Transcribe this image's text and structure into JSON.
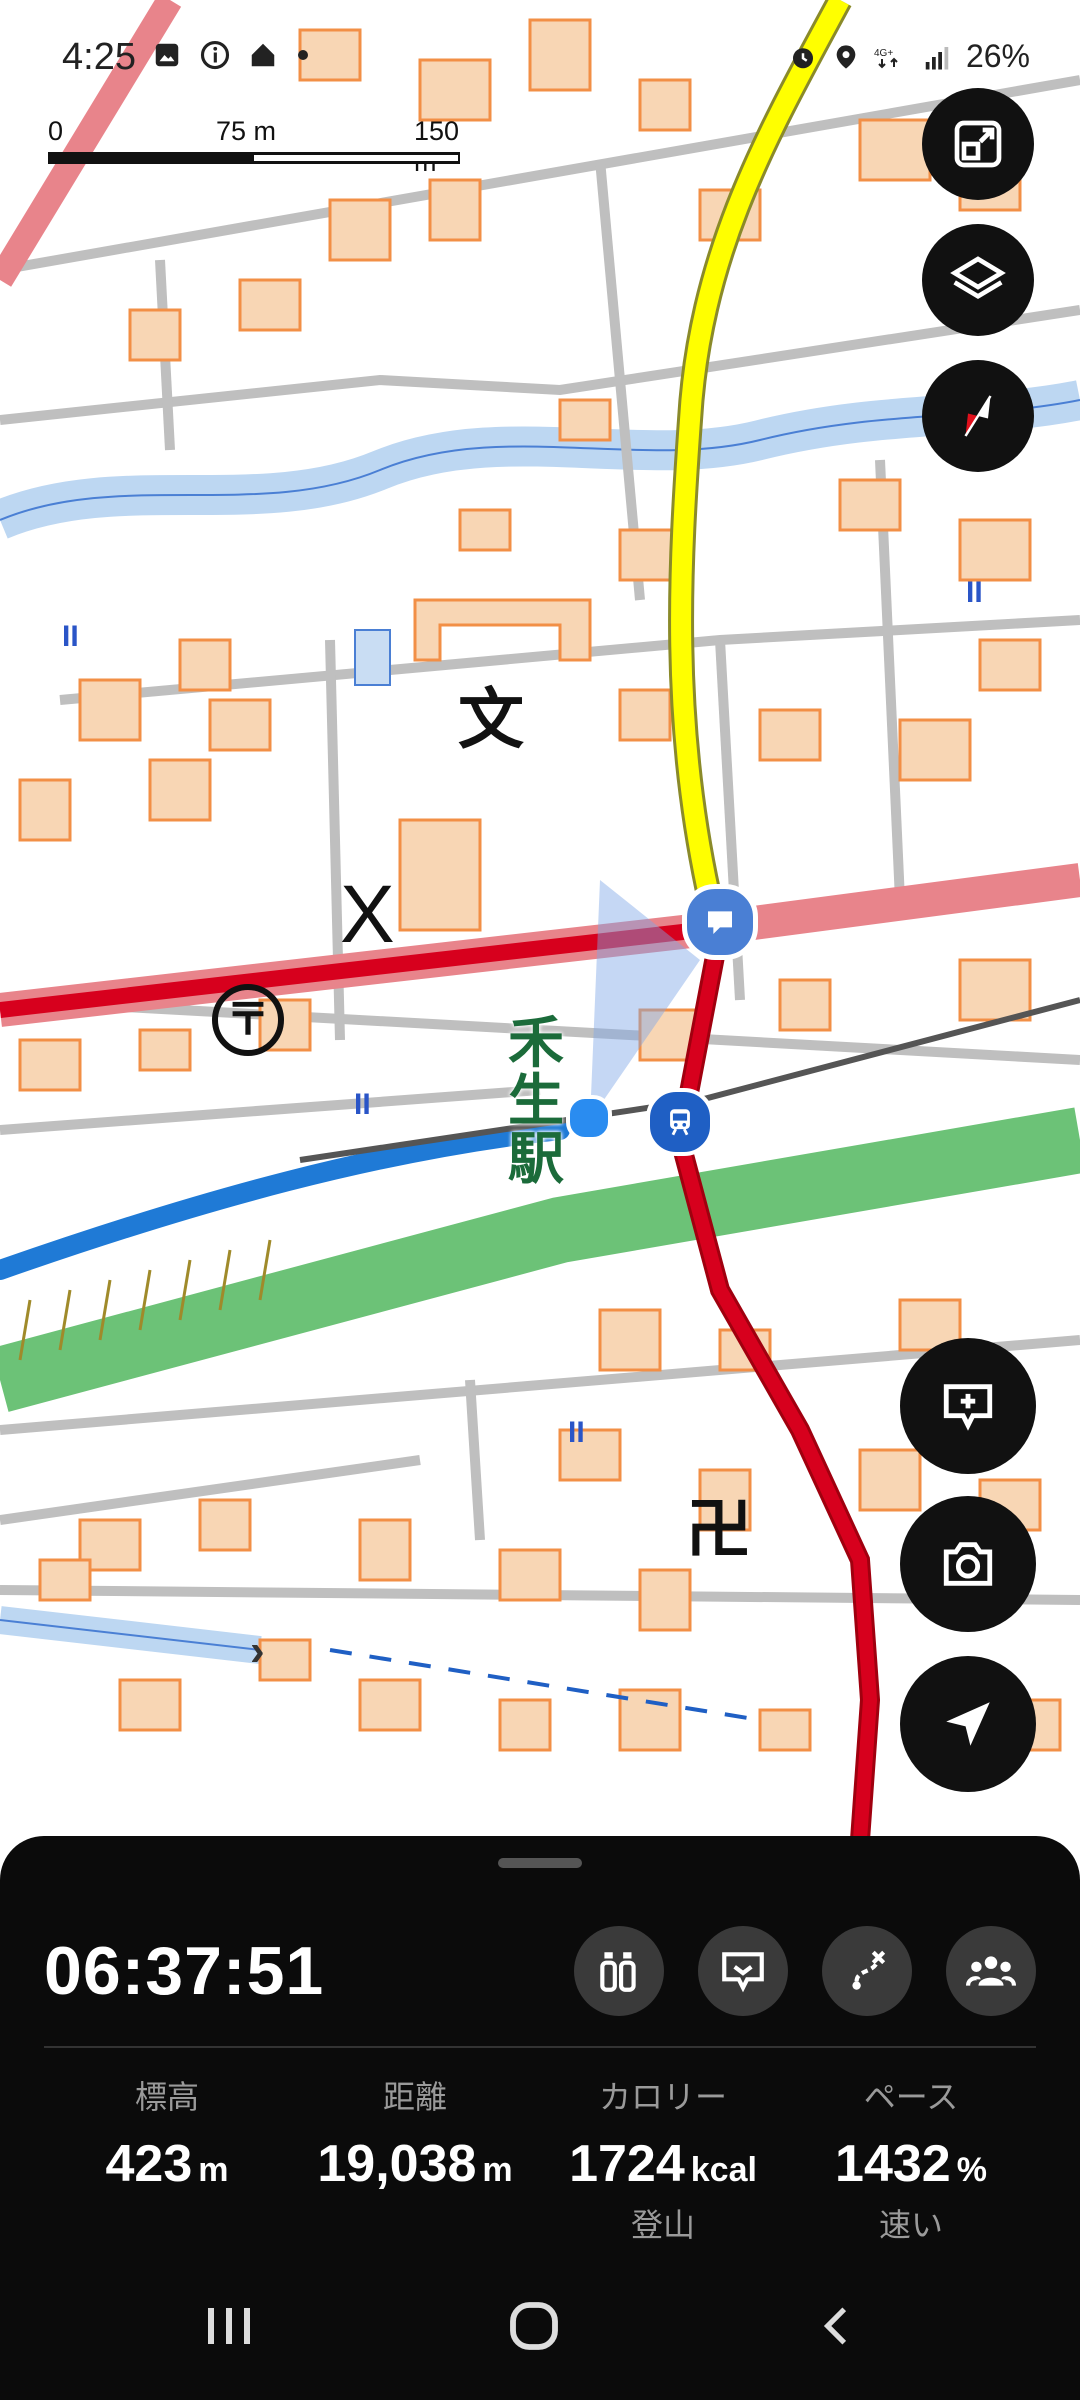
{
  "status_bar": {
    "time": "4:25",
    "battery": "26%",
    "left_icons": [
      "gallery-icon",
      "info-icon",
      "home-icon",
      "dot-icon"
    ],
    "right_icons": [
      "alarm-icon",
      "location-icon",
      "lte-icon",
      "signal-icon"
    ]
  },
  "scale_bar": {
    "label_0": "0",
    "label_1": "75 m",
    "label_2": "150 m"
  },
  "map": {
    "station_label_1": "禾",
    "station_label_2": "生",
    "station_label_3": "駅",
    "symbol_school": "文",
    "symbol_police": "X",
    "symbol_temple": "卍",
    "symbol_post": "〒",
    "symbol_field": "II",
    "colors": {
      "national_road": "#d7001d",
      "prefectural_road": "#ffff00",
      "rail_green": "#6cc277",
      "water": "#bdd7f2",
      "building": "#f8d6b4",
      "building_edge": "#f28f46"
    }
  },
  "map_controls": [
    "fit-screen-icon",
    "layers-icon",
    "compass-icon",
    "zoom-in-icon",
    "camera-icon",
    "navigate-icon"
  ],
  "panel": {
    "elapsed_time": "06:37:51",
    "action_icons": [
      "waypoint-icon",
      "memo-icon",
      "route-icon",
      "group-icon"
    ],
    "stats": [
      {
        "label": "標高",
        "value": "423",
        "unit": "m",
        "sub": ""
      },
      {
        "label": "距離",
        "value": "19,038",
        "unit": "m",
        "sub": ""
      },
      {
        "label": "カロリー",
        "value": "1724",
        "unit": "kcal",
        "sub": "登山"
      },
      {
        "label": "ペース",
        "value": "1432",
        "unit": "%",
        "sub": "速い"
      }
    ]
  },
  "nav_bar": [
    "recents-button",
    "home-button",
    "back-button"
  ]
}
